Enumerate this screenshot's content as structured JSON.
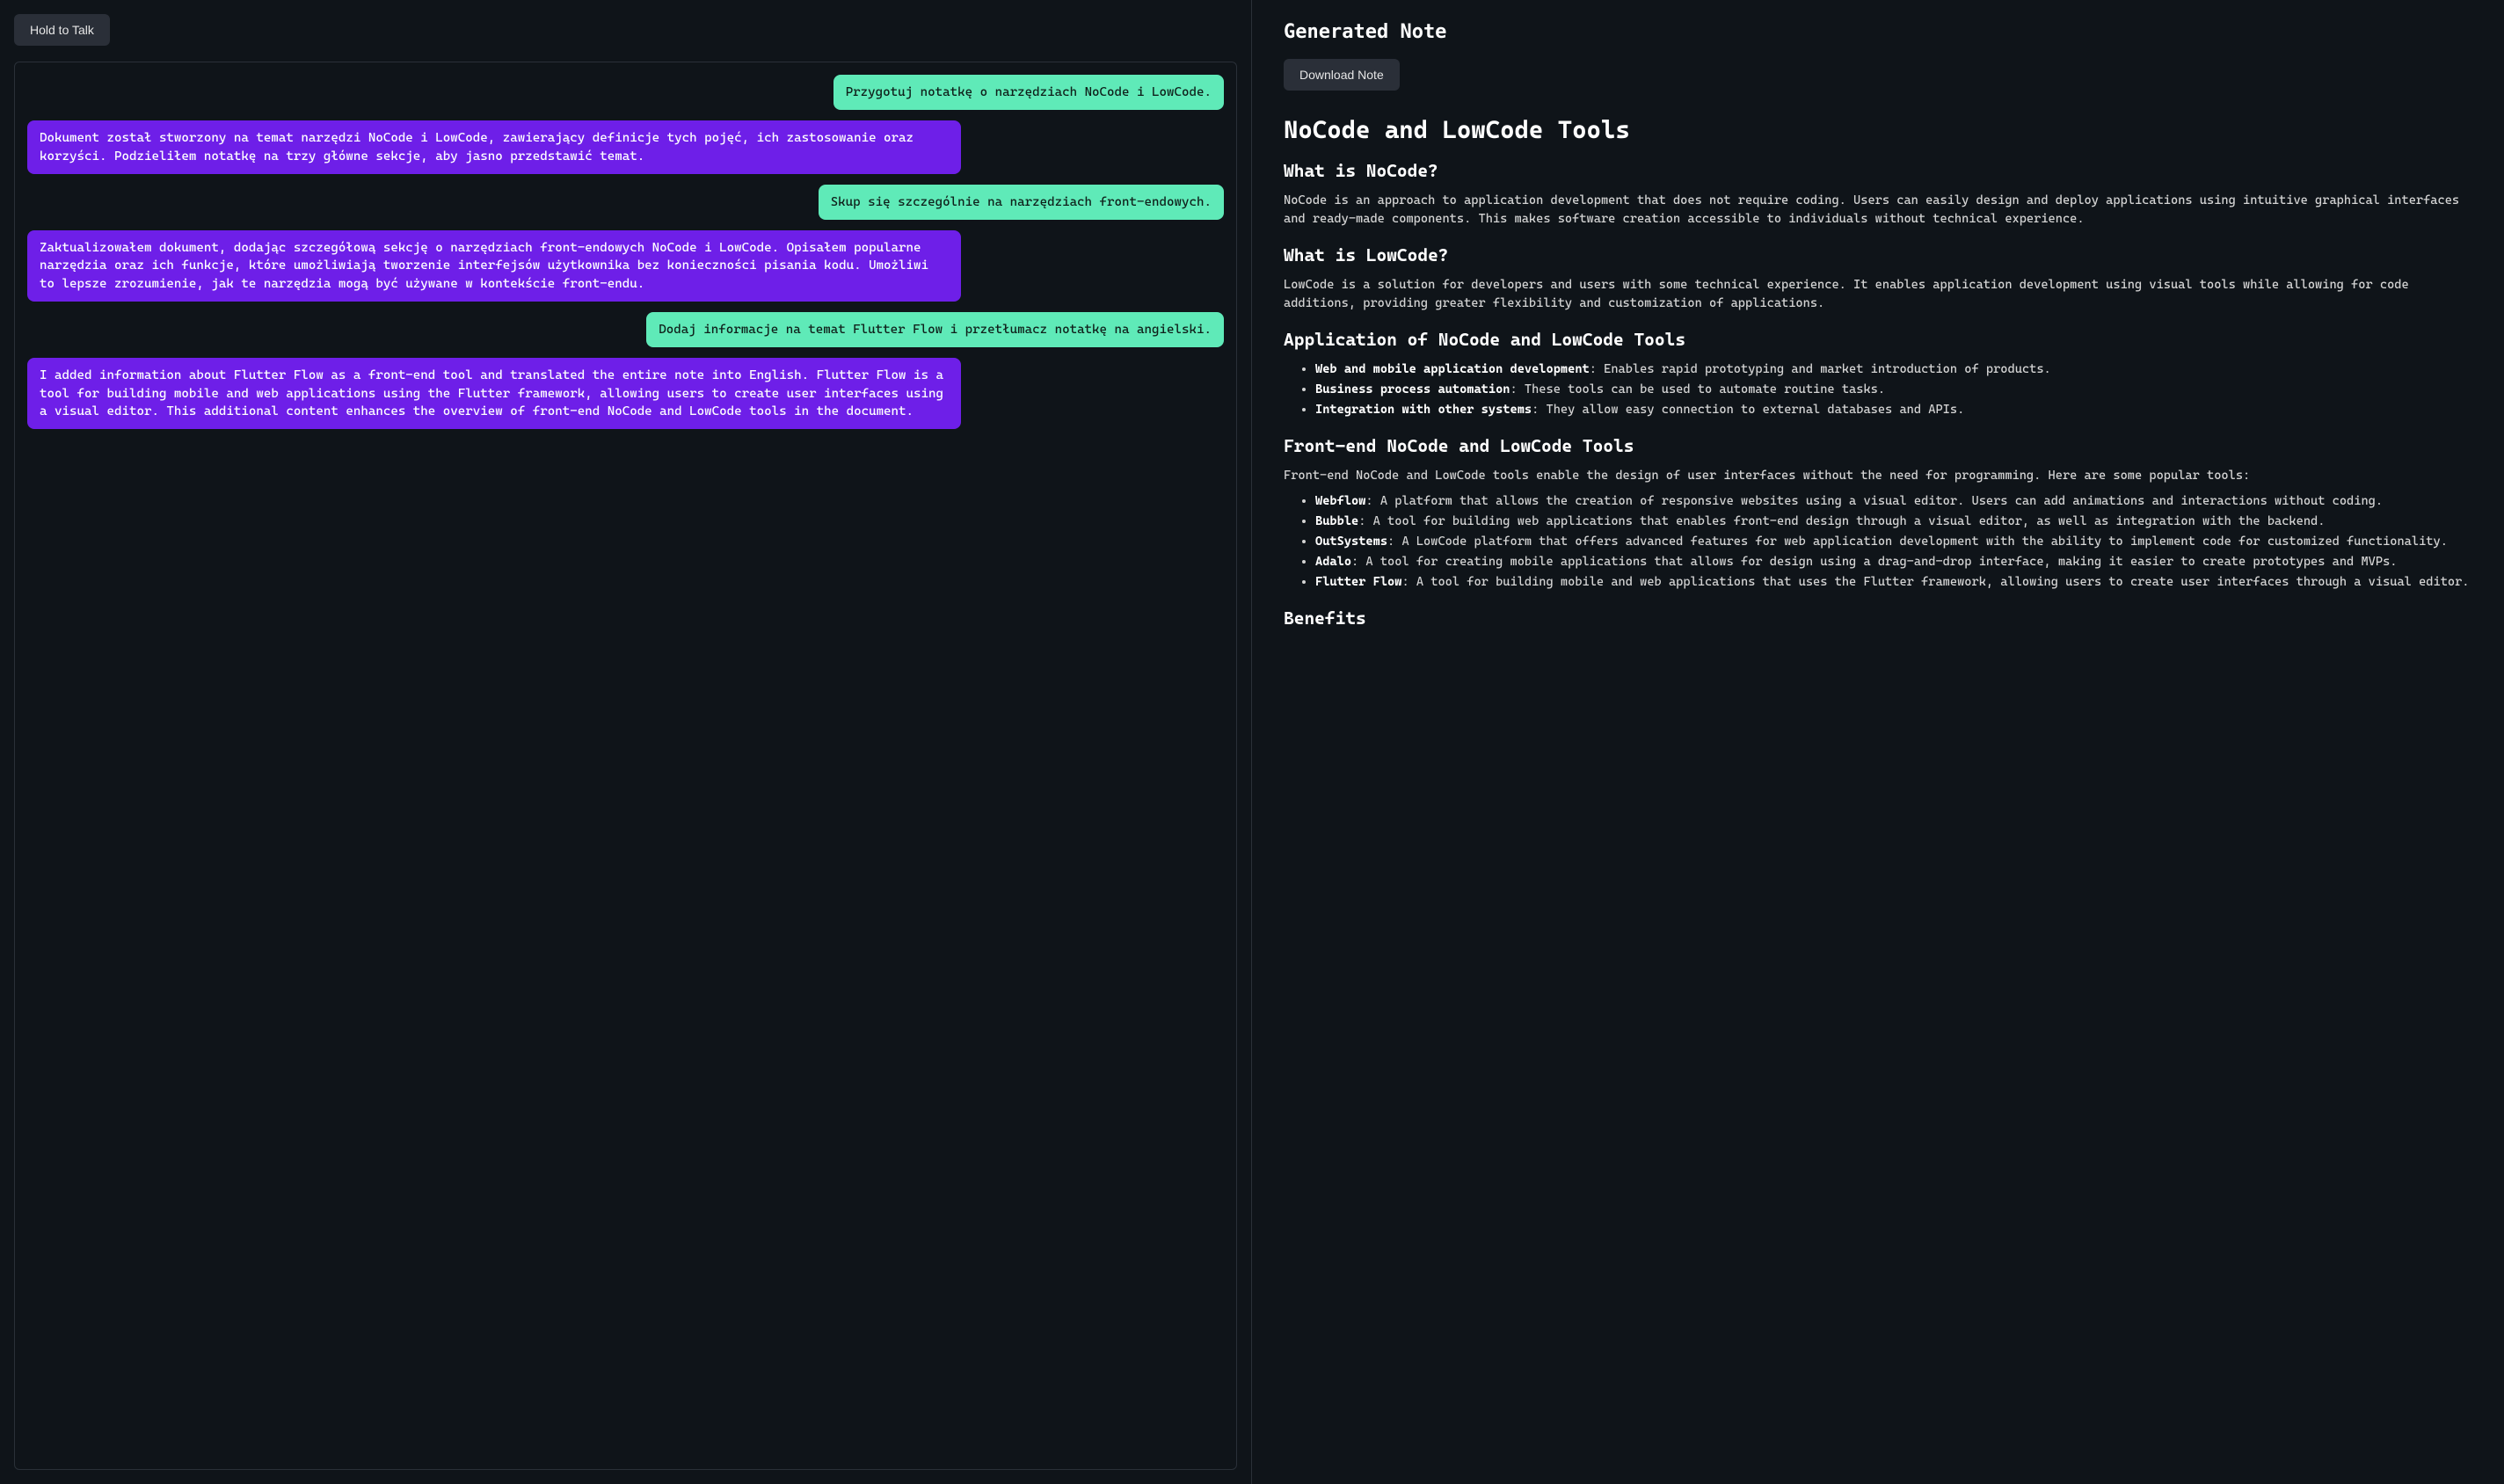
{
  "left": {
    "hold_button": "Hold to Talk",
    "messages": [
      {
        "role": "user",
        "text": "Przygotuj notatkę o narzędziach NoCode i LowCode."
      },
      {
        "role": "assistant",
        "text": "Dokument został stworzony na temat narzędzi NoCode i LowCode, zawierający definicje tych pojęć, ich zastosowanie oraz korzyści. Podzieliłem notatkę na trzy główne sekcje, aby jasno przedstawić temat."
      },
      {
        "role": "user",
        "text": "Skup się szczególnie na narzędziach front-endowych."
      },
      {
        "role": "assistant",
        "text": "Zaktualizowałem dokument, dodając szczegółową sekcję o narzędziach front-endowych NoCode i LowCode. Opisałem popularne narzędzia oraz ich funkcje, które umożliwiają tworzenie interfejsów użytkownika bez konieczności pisania kodu. Umożliwi to lepsze zrozumienie, jak te narzędzia mogą być używane w kontekście front-endu."
      },
      {
        "role": "user",
        "text": "Dodaj informacje na temat Flutter Flow i przetłumacz notatkę na angielski."
      },
      {
        "role": "assistant",
        "text": "I added information about Flutter Flow as a front-end tool and translated the entire note into English. Flutter Flow is a tool for building mobile and web applications using the Flutter framework, allowing users to create user interfaces using a visual editor. This additional content enhances the overview of front-end NoCode and LowCode tools in the document."
      }
    ]
  },
  "right": {
    "header": "Generated Note",
    "download_button": "Download Note",
    "note": {
      "title": "NoCode and LowCode Tools",
      "sec_nocode": {
        "heading": "What is NoCode?",
        "body": "NoCode is an approach to application development that does not require coding. Users can easily design and deploy applications using intuitive graphical interfaces and ready-made components. This makes software creation accessible to individuals without technical experience."
      },
      "sec_lowcode": {
        "heading": "What is LowCode?",
        "body": "LowCode is a solution for developers and users with some technical experience. It enables application development using visual tools while allowing for code additions, providing greater flexibility and customization of applications."
      },
      "sec_app": {
        "heading": "Application of NoCode and LowCode Tools",
        "items": [
          {
            "term": "Web and mobile application development",
            "desc": ": Enables rapid prototyping and market introduction of products."
          },
          {
            "term": "Business process automation",
            "desc": ": These tools can be used to automate routine tasks."
          },
          {
            "term": "Integration with other systems",
            "desc": ": They allow easy connection to external databases and APIs."
          }
        ]
      },
      "sec_frontend": {
        "heading": "Front-end NoCode and LowCode Tools",
        "intro": "Front-end NoCode and LowCode tools enable the design of user interfaces without the need for programming. Here are some popular tools:",
        "items": [
          {
            "term": "Webflow",
            "desc": ": A platform that allows the creation of responsive websites using a visual editor. Users can add animations and interactions without coding."
          },
          {
            "term": "Bubble",
            "desc": ": A tool for building web applications that enables front-end design through a visual editor, as well as integration with the backend."
          },
          {
            "term": "OutSystems",
            "desc": ": A LowCode platform that offers advanced features for web application development with the ability to implement code for customized functionality."
          },
          {
            "term": "Adalo",
            "desc": ": A tool for creating mobile applications that allows for design using a drag-and-drop interface, making it easier to create prototypes and MVPs."
          },
          {
            "term": "Flutter Flow",
            "desc": ": A tool for building mobile and web applications that uses the Flutter framework, allowing users to create user interfaces through a visual editor."
          }
        ]
      },
      "sec_benefits": {
        "heading": "Benefits"
      }
    }
  }
}
